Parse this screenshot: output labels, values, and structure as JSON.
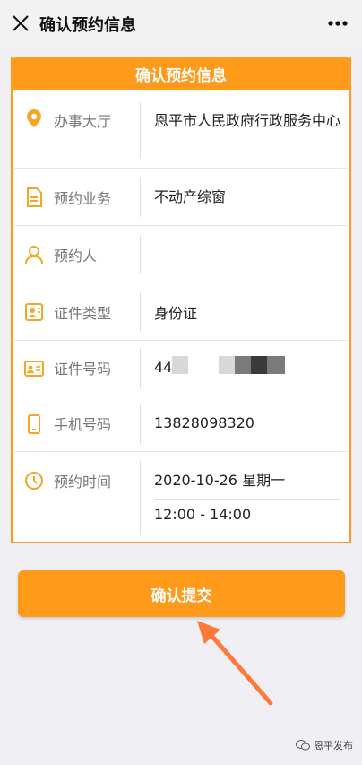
{
  "header": {
    "title": "确认预约信息"
  },
  "card": {
    "title": "确认预约信息"
  },
  "rows": [
    {
      "label": "办事大厅",
      "value": "恩平市人民政府行政服务中心",
      "icon": "location-pin-icon"
    },
    {
      "label": "预约业务",
      "value": "不动产综窗",
      "icon": "document-icon"
    },
    {
      "label": "预约人",
      "value": "",
      "icon": "person-icon"
    },
    {
      "label": "证件类型",
      "value": "身份证",
      "icon": "id-card-icon"
    },
    {
      "label": "证件号码",
      "value": "44",
      "icon": "id-number-card-icon"
    },
    {
      "label": "手机号码",
      "value": "13828098320",
      "icon": "phone-icon"
    },
    {
      "label": "预约时间",
      "date": "2020-10-26  星期一",
      "time": "12:00 - 14:00",
      "icon": "clock-icon"
    }
  ],
  "buttons": {
    "submit": "确认提交"
  },
  "watermark": {
    "text": "恩平发布"
  },
  "colors": {
    "accent": "#ff9a1a",
    "background": "#efeff4"
  }
}
